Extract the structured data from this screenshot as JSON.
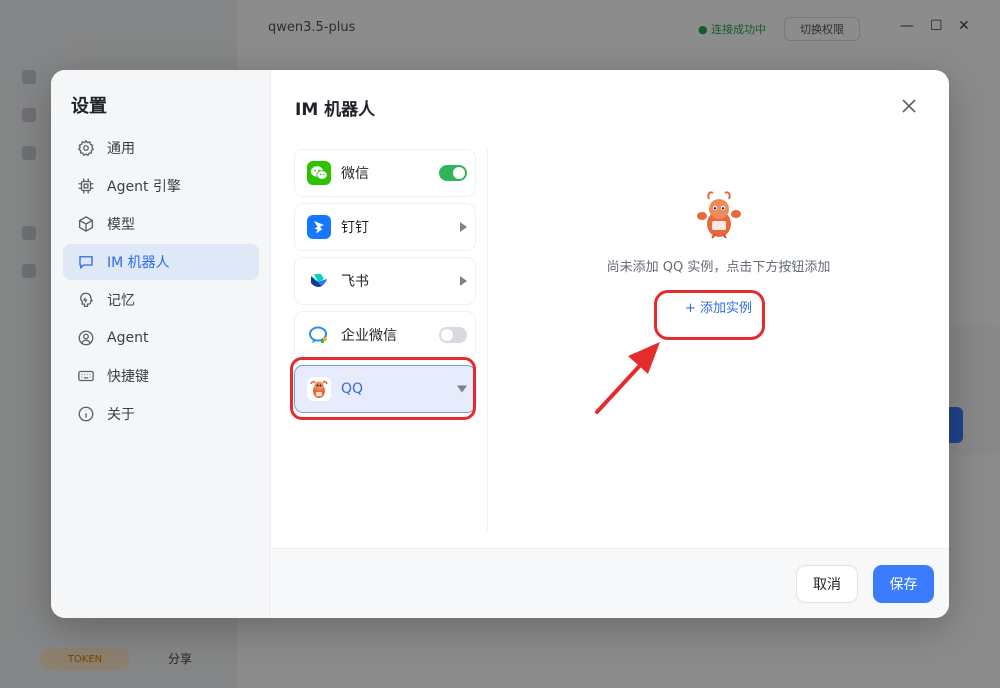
{
  "background": {
    "model_label": "qwen3.5-plus",
    "status_label": "● 连接成功中",
    "pill_label": "切换权限",
    "credit_label": "TOKEN",
    "bottom_label": "分享"
  },
  "settings": {
    "title": "设置",
    "nav": [
      {
        "label": "通用",
        "icon": "gear-icon"
      },
      {
        "label": "Agent 引擎",
        "icon": "chip-icon"
      },
      {
        "label": "模型",
        "icon": "cube-icon"
      },
      {
        "label": "IM 机器人",
        "icon": "chat-icon",
        "active": true
      },
      {
        "label": "记忆",
        "icon": "memory-icon"
      },
      {
        "label": "Agent",
        "icon": "user-icon"
      },
      {
        "label": "快捷键",
        "icon": "keyboard-icon"
      },
      {
        "label": "关于",
        "icon": "info-icon"
      }
    ]
  },
  "panel": {
    "title": "IM 机器人",
    "im_list": [
      {
        "label": "微信",
        "control": "toggle-on"
      },
      {
        "label": "钉钉",
        "control": "expand"
      },
      {
        "label": "飞书",
        "control": "expand"
      },
      {
        "label": "企业微信",
        "control": "toggle-off"
      },
      {
        "label": "QQ",
        "control": "collapse",
        "active": true
      }
    ],
    "empty_text": "尚未添加 QQ 实例，点击下方按钮添加",
    "add_label": "+ 添加实例"
  },
  "footer": {
    "cancel_label": "取消",
    "save_label": "保存"
  },
  "colors": {
    "accent": "#3b7cff",
    "active_bg": "#dfe8f7",
    "highlight": "#e52c2c",
    "toggle_on": "#2fb55c"
  }
}
